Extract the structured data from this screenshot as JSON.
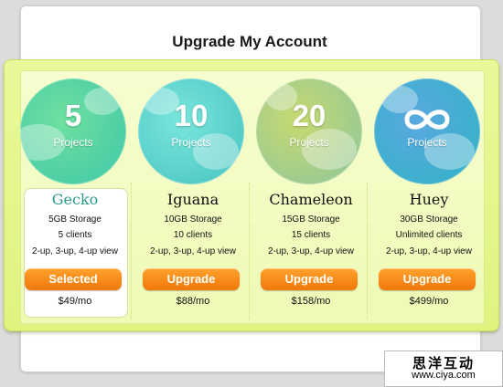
{
  "page": {
    "title": "Upgrade My Account"
  },
  "plans": [
    {
      "count": "5",
      "projects_label": "Projects",
      "name": "Gecko",
      "storage": "5GB Storage",
      "clients": "5 clients",
      "view": "2-up, 3-up, 4-up view",
      "button": "Selected",
      "price": "$49/mo",
      "circle_color": "#5fd39a",
      "circle_color2": "#3fc7a8"
    },
    {
      "count": "10",
      "projects_label": "Projects",
      "name": "Iguana",
      "storage": "10GB Storage",
      "clients": "10 clients",
      "view": "2-up, 3-up, 4-up view",
      "button": "Upgrade",
      "price": "$88/mo",
      "circle_color": "#66ddd0",
      "circle_color2": "#4ec9c4"
    },
    {
      "count": "20",
      "projects_label": "Projects",
      "name": "Chameleon",
      "storage": "15GB Storage",
      "clients": "15 clients",
      "view": "2-up, 3-up, 4-up view",
      "button": "Upgrade",
      "price": "$158/mo",
      "circle_color": "#b7d66a",
      "circle_color2": "#8ec99a"
    },
    {
      "count": "",
      "projects_label": "Projects",
      "name": "Huey",
      "storage": "30GB Storage",
      "clients": "Unlimited clients",
      "view": "2-up, 3-up, 4-up view",
      "button": "Upgrade",
      "price": "$499/mo",
      "circle_color": "#4a9fd8",
      "circle_color2": "#38b8c8",
      "icon": "infinity-icon"
    }
  ],
  "colors": {
    "band": "#e4f68c",
    "button": "#f5860f",
    "selected_name": "#2a9a8c"
  },
  "watermark": {
    "cn": "思洋互动",
    "url": "www.ciya.com"
  }
}
